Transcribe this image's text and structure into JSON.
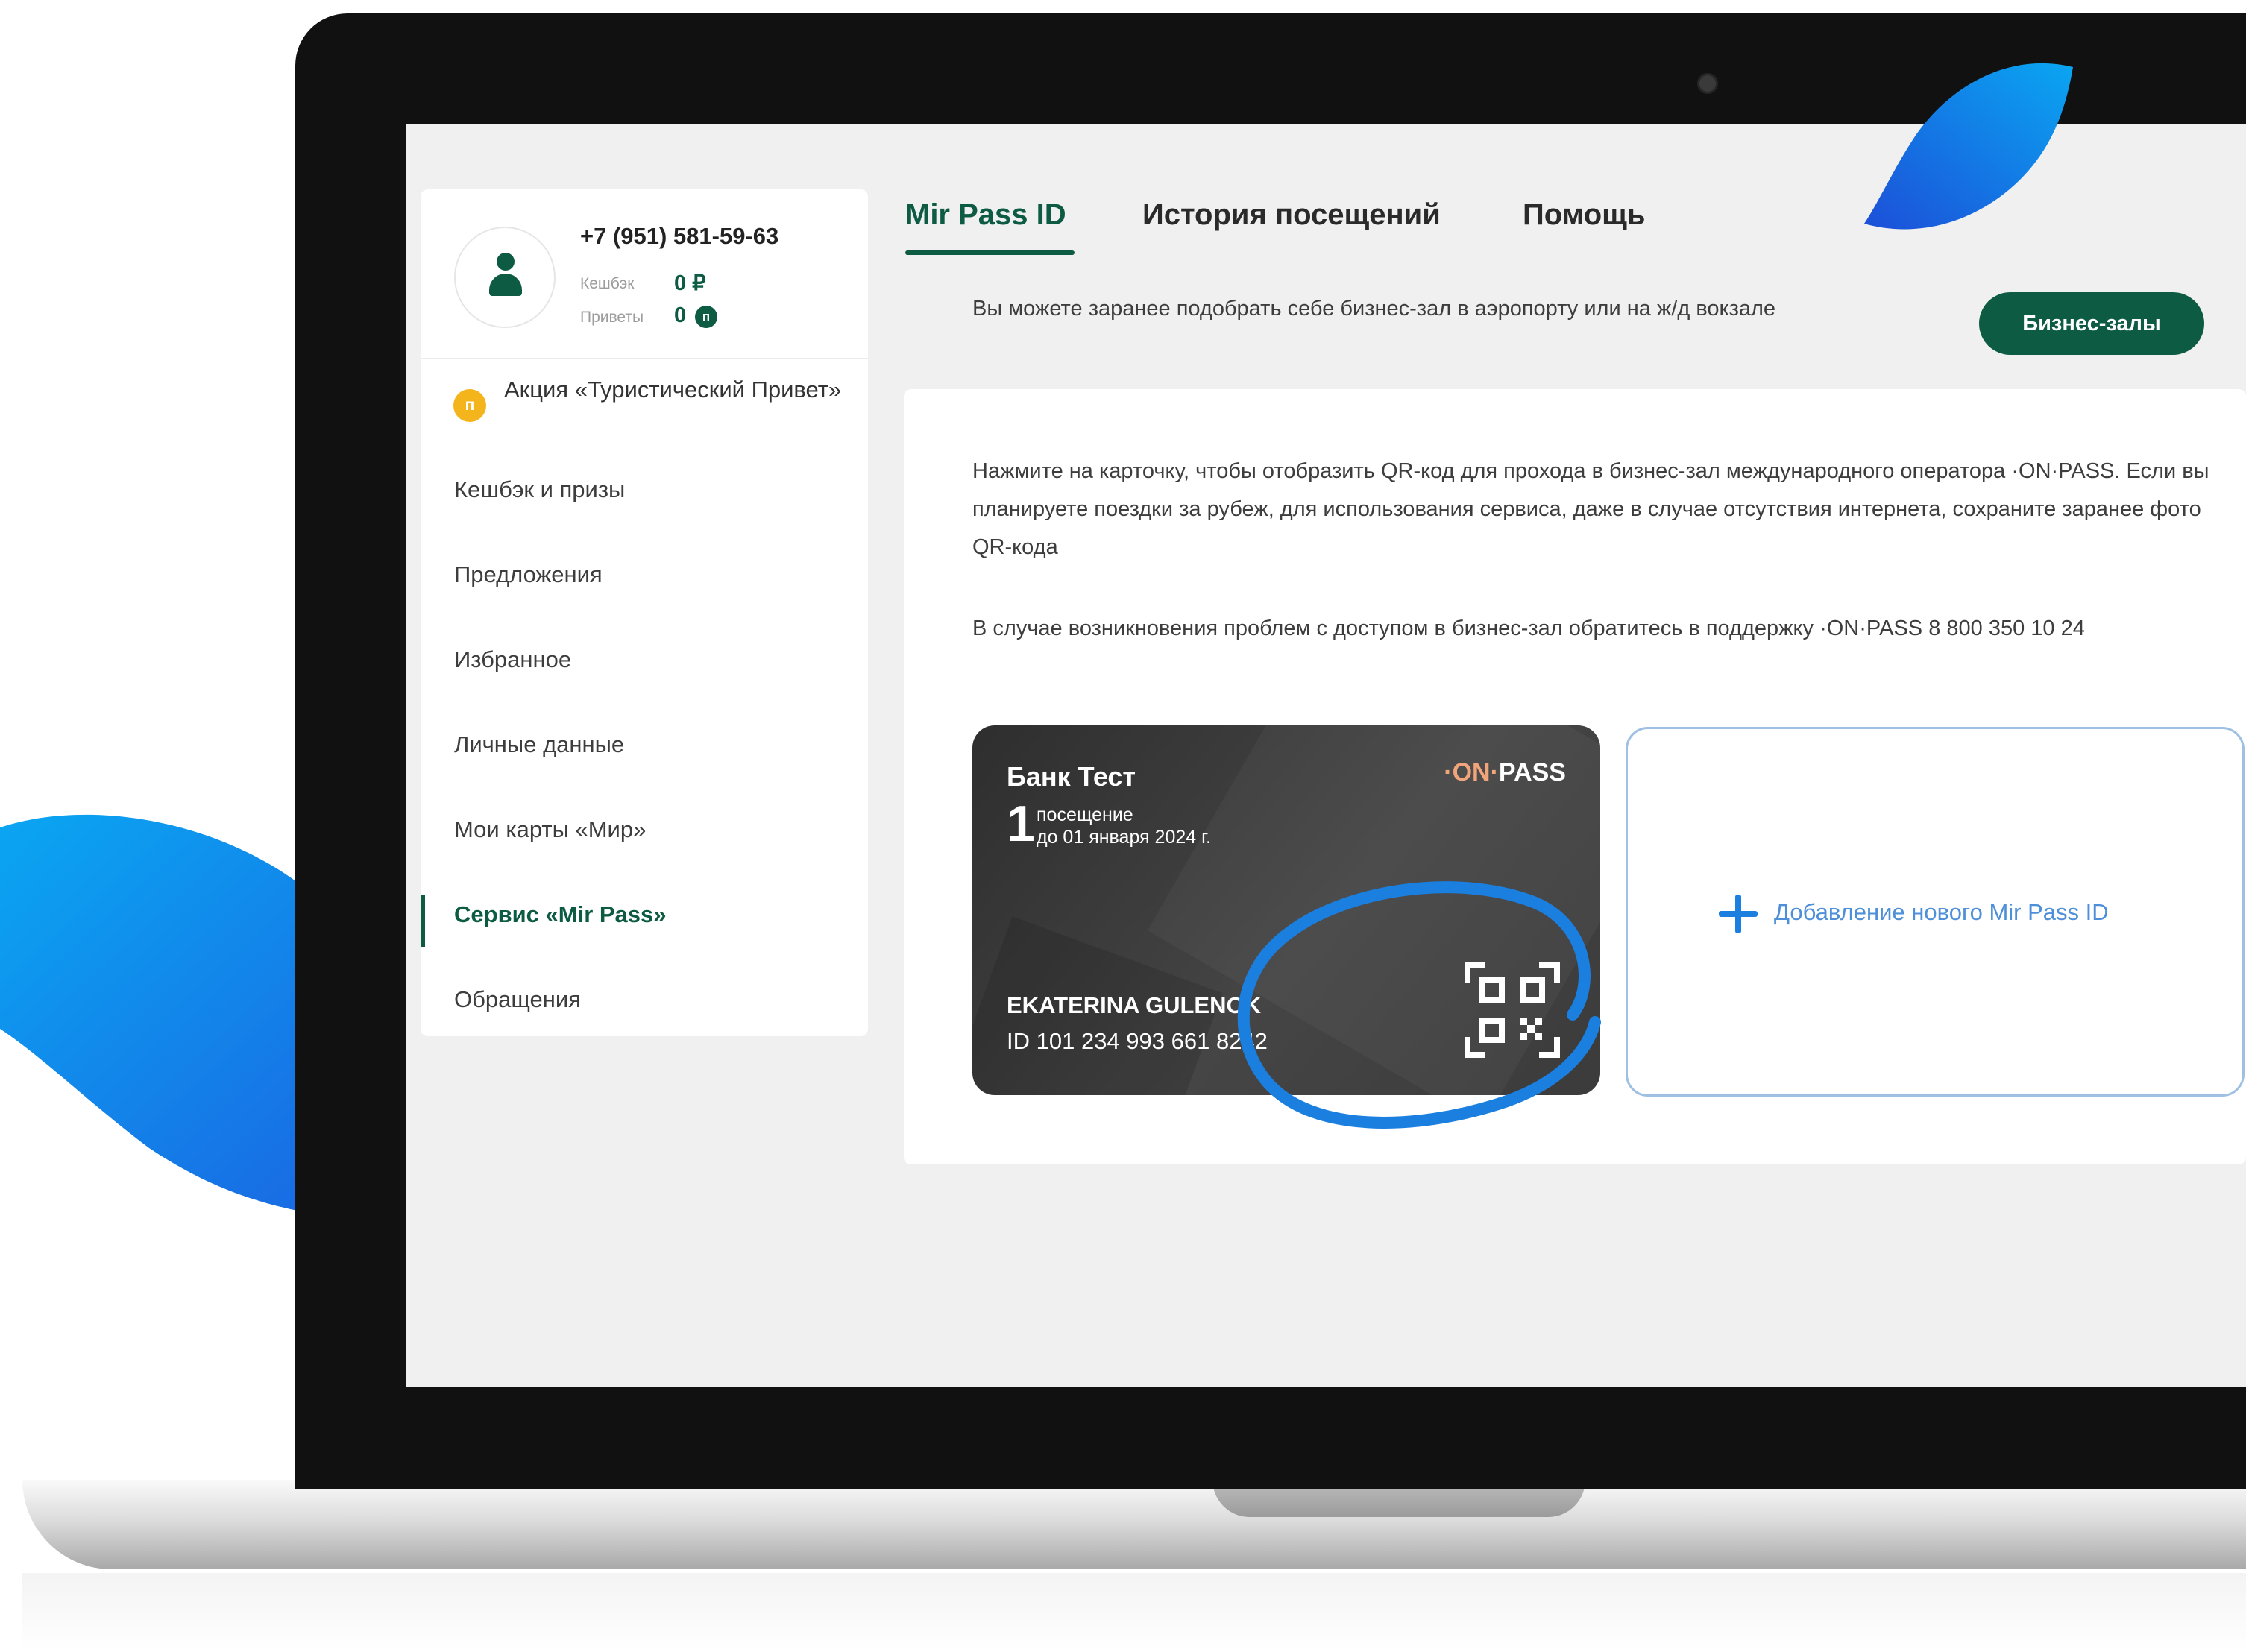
{
  "colors": {
    "brand_green": "#0c5b42",
    "accent_blue": "#1b7fe0",
    "promo_gold": "#f3b51b"
  },
  "profile": {
    "phone": "+7 (951) 581-59-63",
    "cashback_label": "Кешбэк",
    "cashback_value": "0 ₽",
    "greetings_label": "Приветы",
    "greetings_value": "0",
    "coin_icon_letter": "п"
  },
  "sidebar": {
    "promo_icon_letter": "п",
    "promo_label": "Акция «Туристический Привет»",
    "items": [
      {
        "label": "Кешбэк и призы"
      },
      {
        "label": "Предложения"
      },
      {
        "label": "Избранное"
      },
      {
        "label": "Личные данные"
      },
      {
        "label": "Мои карты «Мир»"
      },
      {
        "label": "Сервис «Mir Pass»",
        "active": true
      },
      {
        "label": "Обращения"
      }
    ]
  },
  "tabs": [
    {
      "label": "Mir Pass ID",
      "active": true
    },
    {
      "label": "История посещений"
    },
    {
      "label": "Помощь"
    }
  ],
  "info": {
    "text": "Вы можете заранее подобрать себе бизнес-зал в аэропорту или на ж/д вокзале",
    "button_label": "Бизнес-залы"
  },
  "panel": {
    "paragraph1": "Нажмите на карточку, чтобы отобразить QR-код для прохода в бизнес-зал международного оператора ·ON·PASS. Если вы планируете поездки за рубеж, для использования сервиса, даже в случае отсутствия интернета, сохраните заранее фото QR-кода",
    "paragraph2": "В случае возникновения проблем с доступом в бизнес-зал обратитесь в поддержку ·ON·PASS 8 800 350 10 24"
  },
  "pass_card": {
    "bank_name": "Банк Тест",
    "logo_on": "·ON·",
    "logo_pass": "PASS",
    "visits": "1",
    "visits_label": "посещение",
    "valid_until": "до 01 января 2024 г.",
    "holder": "EKATERINA GULENOK",
    "id": "ID 101 234 993 661 8242",
    "icon": "qr-code-icon"
  },
  "add_card": {
    "label": "Добавление нового Mir Pass ID",
    "icon": "plus-icon"
  }
}
